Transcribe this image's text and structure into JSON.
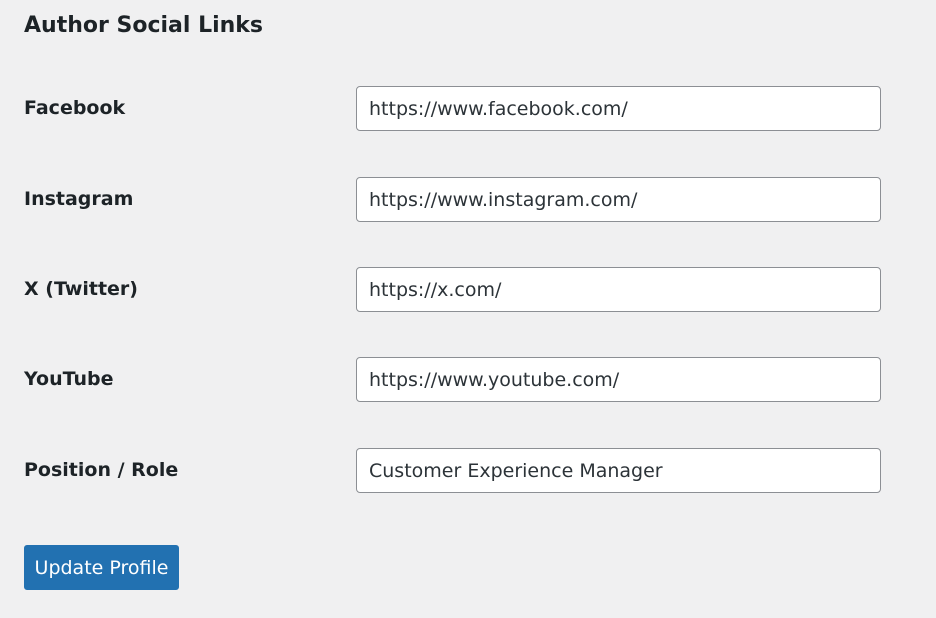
{
  "section": {
    "title": "Author Social Links"
  },
  "fields": [
    {
      "label": "Facebook",
      "value": "https://www.facebook.com/"
    },
    {
      "label": "Instagram",
      "value": "https://www.instagram.com/"
    },
    {
      "label": "X (Twitter)",
      "value": "https://x.com/"
    },
    {
      "label": "YouTube",
      "value": "https://www.youtube.com/"
    },
    {
      "label": "Position / Role",
      "value": "Customer Experience Manager"
    }
  ],
  "actions": {
    "submit_label": "Update Profile"
  },
  "colors": {
    "background": "#f0f0f1",
    "primary_button": "#2271b1",
    "input_border": "#8c8f94"
  }
}
